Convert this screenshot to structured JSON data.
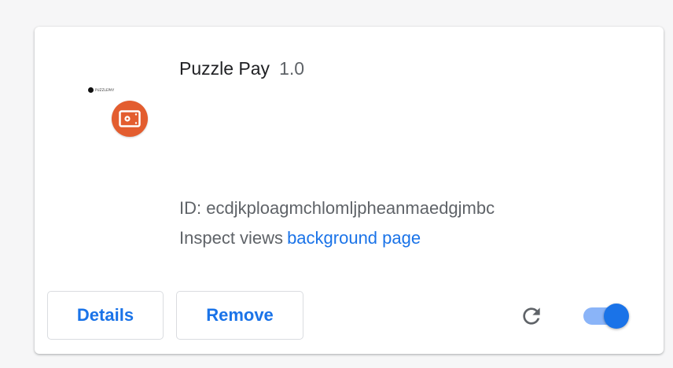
{
  "extension": {
    "name": "Puzzle Pay",
    "version": "1.0",
    "id_label": "ID:",
    "id_value": "ecdjkploagmchlomljpheanmaedgjmbc",
    "inspect_label": "Inspect views",
    "inspect_link": "background page",
    "logo_text": "PUZZLEPAY",
    "enabled": true
  },
  "buttons": {
    "details": "Details",
    "remove": "Remove"
  },
  "icons": {
    "badge": "wallet-icon",
    "reload": "reload-icon"
  },
  "colors": {
    "accent": "#1a73e8",
    "badge": "#e35d2f",
    "toggle_track": "#8ab4f8"
  }
}
